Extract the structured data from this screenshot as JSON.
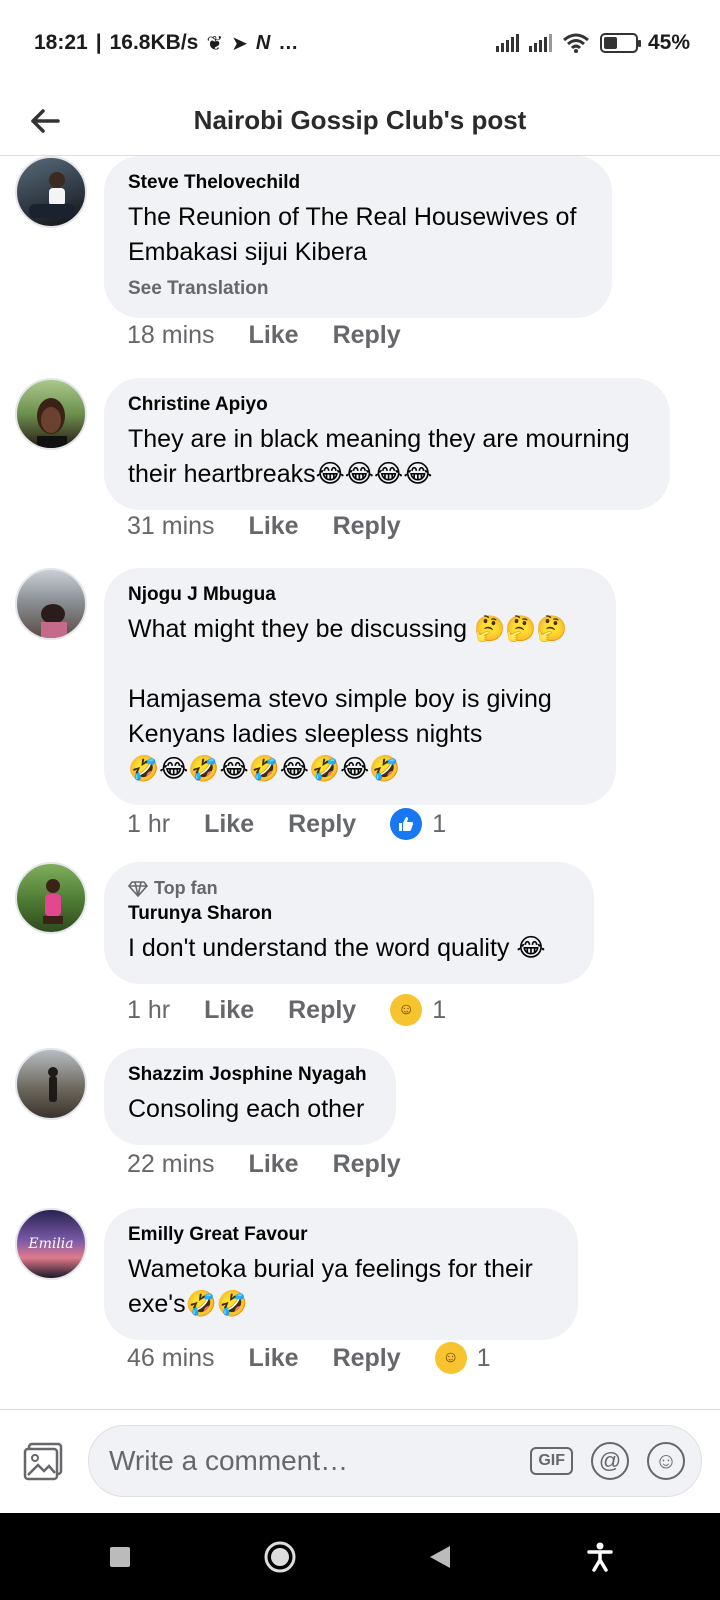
{
  "status": {
    "time": "18:21",
    "network_speed": "16.8KB/s",
    "extra_icons": "…",
    "battery": "45%"
  },
  "header": {
    "title": "Nairobi Gossip Club's post"
  },
  "comments": [
    {
      "author": "Steve Thelovechild",
      "text": "The Reunion of The Real Housewives of Embakasi sijui Kibera",
      "translate": "See Translation",
      "time": "18 mins",
      "like": "Like",
      "reply": "Reply"
    },
    {
      "author": "Christine Apiyo",
      "text": "They are in black meaning they are mourning their heartbreaks😂😂😂😂",
      "time": "31 mins",
      "like": "Like",
      "reply": "Reply"
    },
    {
      "author": "Njogu J Mbugua",
      "text": "What might they be discussing 🤔🤔🤔\n\nHamjasema stevo simple boy is giving Kenyans ladies sleepless nights\n🤣😂🤣😂🤣😂🤣😂🤣",
      "time": "1 hr",
      "like": "Like",
      "reply": "Reply",
      "reaction_count": "1"
    },
    {
      "badge": "Top fan",
      "author": "Turunya Sharon",
      "text": "I don't understand the word quality 😂",
      "time": "1 hr",
      "like": "Like",
      "reply": "Reply",
      "reaction_count": "1"
    },
    {
      "author": "Shazzim Josphine Nyagah",
      "text": "Consoling each other",
      "time": "22 mins",
      "like": "Like",
      "reply": "Reply"
    },
    {
      "author": "Emilly Great Favour",
      "avatar_text": "Emilia",
      "text": "Wametoka burial ya feelings for their exe's🤣🤣",
      "time": "46 mins",
      "like": "Like",
      "reply": "Reply",
      "reaction_count": "1"
    }
  ],
  "composer": {
    "placeholder": "Write a comment…",
    "gif_label": "GIF",
    "mention_label": "@",
    "emoji_label": "☺"
  },
  "colors": {
    "bubble": "#f0f2f5",
    "secondary_text": "#65676b",
    "like_blue": "#1877f2",
    "haha_yellow": "#f7c42f"
  }
}
